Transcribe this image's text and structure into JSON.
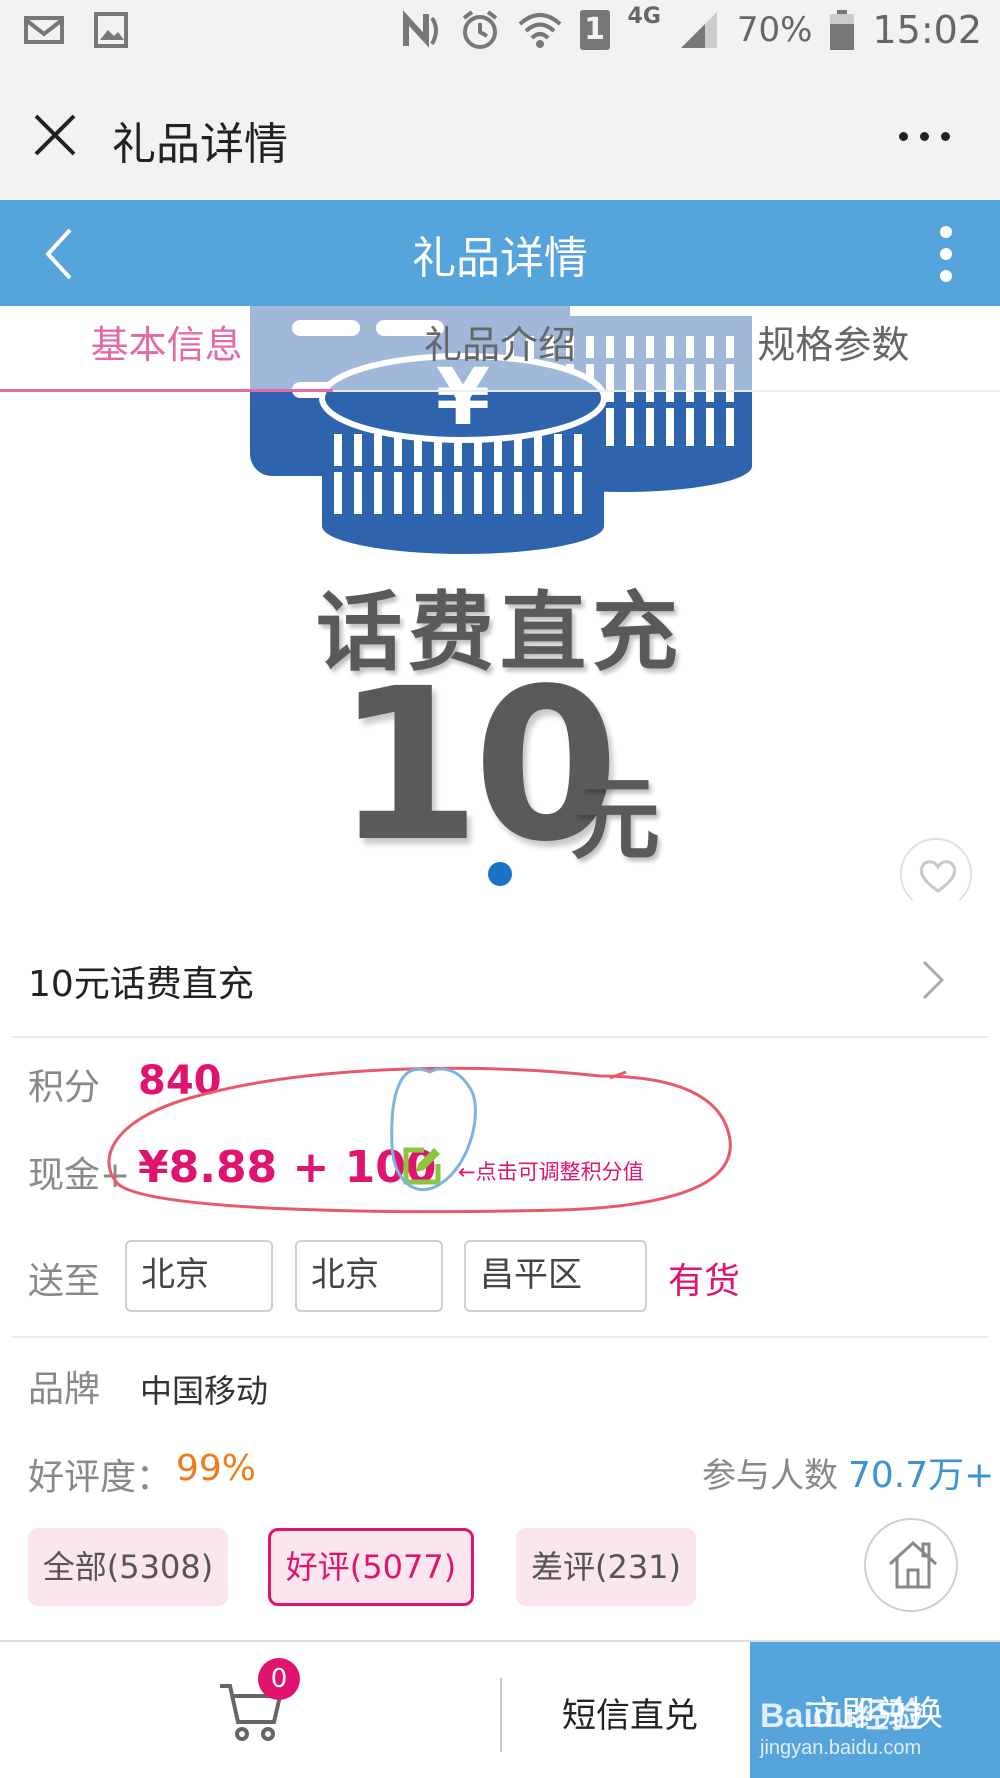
{
  "status_bar": {
    "signal_type": "4G",
    "sim_slot": "1",
    "battery": "70%",
    "time": "15:02",
    "icons": [
      "mail-icon",
      "image-icon",
      "nfc-icon",
      "alarm-icon",
      "wifi-icon",
      "sim-icon",
      "signal-icon",
      "battery-icon"
    ]
  },
  "webview": {
    "title": "礼品详情",
    "close_icon": "close-icon",
    "more_icon": "more-horizontal-icon"
  },
  "app_header": {
    "title": "礼品详情",
    "back_icon": "chevron-left-icon",
    "menu_icon": "more-vertical-icon"
  },
  "tabs": [
    {
      "label": "基本信息",
      "active": true
    },
    {
      "label": "礼品介绍",
      "active": false
    },
    {
      "label": "规格参数",
      "active": false
    }
  ],
  "banner": {
    "headline": "话费直充",
    "amount": "10",
    "unit": "元",
    "slide_count": 1,
    "current_slide": 1
  },
  "product": {
    "title": "10元话费直充"
  },
  "pricing": {
    "points_label": "积分",
    "points_value": "840",
    "cash_label": "现金+",
    "cash_value": "¥8.88 + 100",
    "edit_hint": "←点击可调整积分值"
  },
  "delivery": {
    "label": "送至",
    "province": "北京",
    "city": "北京",
    "district": "昌平区",
    "stock": "有货"
  },
  "brand": {
    "label": "品牌",
    "value": "中国移动"
  },
  "rating": {
    "label": "好评度：",
    "value": "99%",
    "participants_label": "参与人数",
    "participants_value": "70.7万+"
  },
  "reviews": [
    {
      "label": "全部(5308)",
      "active": false
    },
    {
      "label": "好评(5077)",
      "active": true
    },
    {
      "label": "差评(231)",
      "active": false
    }
  ],
  "bottom_bar": {
    "cart_count": "0",
    "sms_label": "短信直兑",
    "redeem_label": "立即兑换"
  },
  "watermark": {
    "line1": "Baidu经验",
    "line2": "jingyan.baidu.com"
  },
  "colors": {
    "header_blue": "#56a4dc",
    "accent_pink": "#e0146e",
    "tab_pink": "#e36aa5",
    "rating_orange": "#f07b1c",
    "link_blue": "#3a93d6",
    "annotation_red": "#e85a6a",
    "annotation_blue": "#7fb2e0"
  }
}
